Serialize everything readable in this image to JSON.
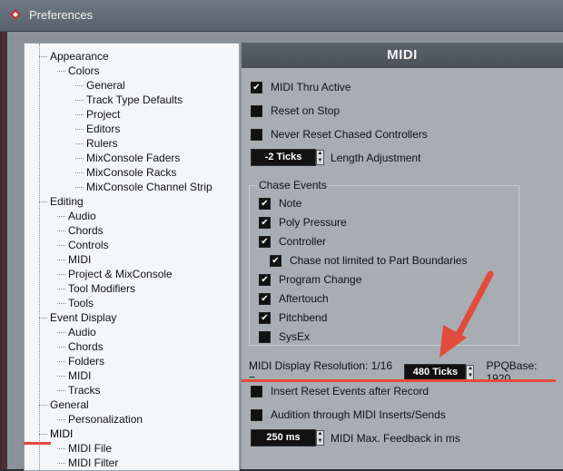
{
  "window": {
    "title": "Preferences"
  },
  "tree": [
    {
      "label": "Appearance",
      "level": 0
    },
    {
      "label": "Colors",
      "level": 1
    },
    {
      "label": "General",
      "level": 2
    },
    {
      "label": "Track Type Defaults",
      "level": 2
    },
    {
      "label": "Project",
      "level": 2
    },
    {
      "label": "Editors",
      "level": 2
    },
    {
      "label": "Rulers",
      "level": 2
    },
    {
      "label": "MixConsole Faders",
      "level": 2
    },
    {
      "label": "MixConsole Racks",
      "level": 2
    },
    {
      "label": "MixConsole Channel Strip",
      "level": 2
    },
    {
      "label": "Editing",
      "level": 0
    },
    {
      "label": "Audio",
      "level": 1
    },
    {
      "label": "Chords",
      "level": 1
    },
    {
      "label": "Controls",
      "level": 1
    },
    {
      "label": "MIDI",
      "level": 1
    },
    {
      "label": "Project & MixConsole",
      "level": 1
    },
    {
      "label": "Tool Modifiers",
      "level": 1
    },
    {
      "label": "Tools",
      "level": 1
    },
    {
      "label": "Event Display",
      "level": 0
    },
    {
      "label": "Audio",
      "level": 1
    },
    {
      "label": "Chords",
      "level": 1
    },
    {
      "label": "Folders",
      "level": 1
    },
    {
      "label": "MIDI",
      "level": 1
    },
    {
      "label": "Tracks",
      "level": 1
    },
    {
      "label": "General",
      "level": 0
    },
    {
      "label": "Personalization",
      "level": 1
    },
    {
      "label": "MIDI",
      "level": 0,
      "selected": true
    },
    {
      "label": "MIDI File",
      "level": 1
    },
    {
      "label": "MIDI Filter",
      "level": 1
    }
  ],
  "panel": {
    "title": "MIDI",
    "midi_thru": {
      "label": "MIDI Thru Active",
      "checked": true
    },
    "reset_on_stop": {
      "label": "Reset on Stop",
      "checked": false
    },
    "never_reset": {
      "label": "Never Reset Chased Controllers",
      "checked": false
    },
    "length_adj": {
      "value": "-2 Ticks",
      "label": "Length Adjustment"
    },
    "chase": {
      "legend": "Chase Events",
      "note": {
        "label": "Note",
        "checked": true
      },
      "poly": {
        "label": "Poly Pressure",
        "checked": true
      },
      "controller": {
        "label": "Controller",
        "checked": true
      },
      "chase_not_limited": {
        "label": "Chase not limited to Part Boundaries",
        "checked": true
      },
      "program_change": {
        "label": "Program Change",
        "checked": true
      },
      "aftertouch": {
        "label": "Aftertouch",
        "checked": true
      },
      "pitchbend": {
        "label": "Pitchbend",
        "checked": true
      },
      "sysex": {
        "label": "SysEx",
        "checked": false
      }
    },
    "resolution": {
      "label": "MIDI Display Resolution: 1/16 =",
      "value": "480 Ticks",
      "ppq": "PPQBase: 1920"
    },
    "insert_reset": {
      "label": "Insert Reset Events after Record",
      "checked": false
    },
    "audition": {
      "label": "Audition through MIDI Inserts/Sends",
      "checked": false
    },
    "feedback": {
      "value": "250 ms",
      "label": "MIDI Max. Feedback in ms"
    }
  },
  "colors": {
    "annotation_red": "#e24b3b",
    "panel_bg": "#a7adb3",
    "header_bg": "#4f575e"
  }
}
